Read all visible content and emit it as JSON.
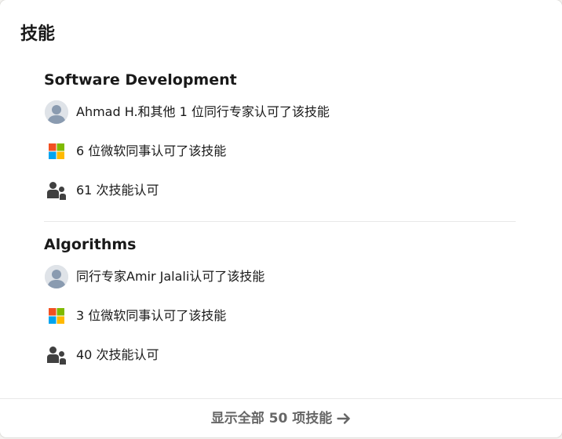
{
  "section": {
    "title": "技能"
  },
  "skills": [
    {
      "name": "Software Development",
      "endorsements": [
        {
          "icon": "avatar",
          "text": "Ahmad H.和其他 1 位同行专家认可了该技能"
        },
        {
          "icon": "microsoft-logo-icon",
          "text": "6 位微软同事认可了该技能"
        },
        {
          "icon": "people-icon",
          "text": "61 次技能认可"
        }
      ]
    },
    {
      "name": "Algorithms",
      "endorsements": [
        {
          "icon": "avatar",
          "text": "同行专家Amir Jalali认可了该技能"
        },
        {
          "icon": "microsoft-logo-icon",
          "text": "3 位微软同事认可了该技能"
        },
        {
          "icon": "people-icon",
          "text": "40 次技能认可"
        }
      ]
    }
  ],
  "footer": {
    "show_all_label": "显示全部 50 项技能",
    "arrow_icon": "arrow-right-icon"
  },
  "colors": {
    "microsoft_red": "#f25022",
    "microsoft_green": "#7fba00",
    "microsoft_blue": "#00a4ef",
    "microsoft_yellow": "#ffb900",
    "muted_text": "#666666",
    "icon_dark": "#404040"
  }
}
